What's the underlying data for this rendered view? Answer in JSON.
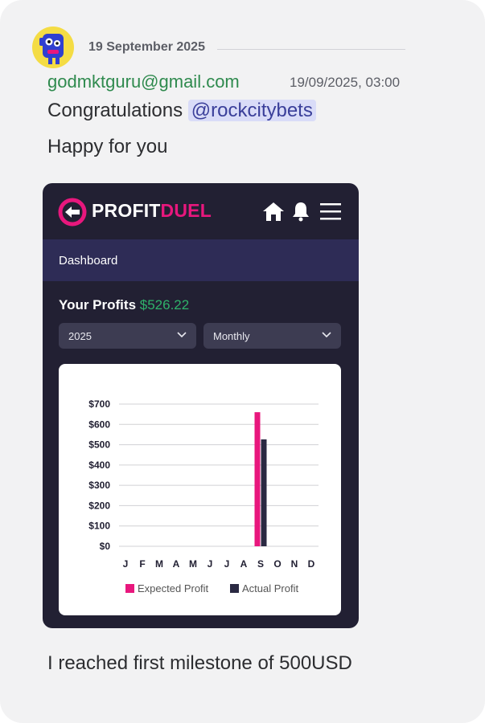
{
  "message": {
    "date_divider": "19 September 2025",
    "author": "godmktguru@gmail.com",
    "timestamp": "19/09/2025, 03:00",
    "line1_prefix": "Congratulations",
    "mention": "@rockcitybets",
    "line2": "Happy for you",
    "line3": "I reached first milestone of 500USD"
  },
  "embed": {
    "logo_part1": "PROFIT",
    "logo_part2": "DUEL",
    "nav_title": "Dashboard",
    "profits_label": "Your Profits",
    "profits_value": "$526.22",
    "year_select": "2025",
    "period_select": "Monthly",
    "icons": [
      "home-icon",
      "bell-icon",
      "menu-icon",
      "chevron-down-icon"
    ],
    "colors": {
      "brand_pink": "#e8177d",
      "profit_green": "#2fb26a",
      "dark_bg": "#222033"
    }
  },
  "chart_data": {
    "type": "bar",
    "categories": [
      "J",
      "F",
      "M",
      "A",
      "M",
      "J",
      "J",
      "A",
      "S",
      "O",
      "N",
      "D"
    ],
    "series": [
      {
        "name": "Expected Profit",
        "color": "#e8177d",
        "values": [
          0,
          0,
          0,
          0,
          0,
          0,
          0,
          0,
          660,
          0,
          0,
          0
        ]
      },
      {
        "name": "Actual Profit",
        "color": "#2a2942",
        "values": [
          0,
          0,
          0,
          0,
          0,
          0,
          0,
          0,
          526.22,
          0,
          0,
          0
        ]
      }
    ],
    "yticks": [
      "$700",
      "$600",
      "$500",
      "$400",
      "$300",
      "$200",
      "$100",
      "$0"
    ],
    "ylim": [
      0,
      700
    ],
    "grid": true,
    "legend": "bottom"
  }
}
